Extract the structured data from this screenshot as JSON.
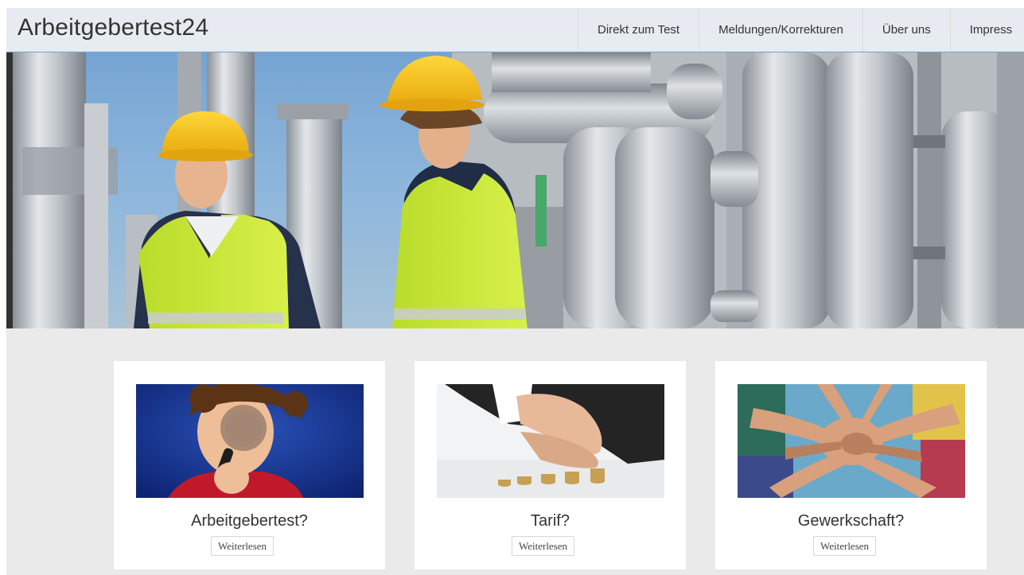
{
  "header": {
    "brand": "Arbeitgebertest24",
    "nav": [
      {
        "label": "Direkt zum Test"
      },
      {
        "label": "Meldungen/Korrekturen"
      },
      {
        "label": "Über uns"
      },
      {
        "label": "Impress"
      }
    ]
  },
  "cards": [
    {
      "title": "Arbeitgebertest?",
      "button": "Weiterlesen"
    },
    {
      "title": "Tarif?",
      "button": "Weiterlesen"
    },
    {
      "title": "Gewerkschaft?",
      "button": "Weiterlesen"
    }
  ]
}
